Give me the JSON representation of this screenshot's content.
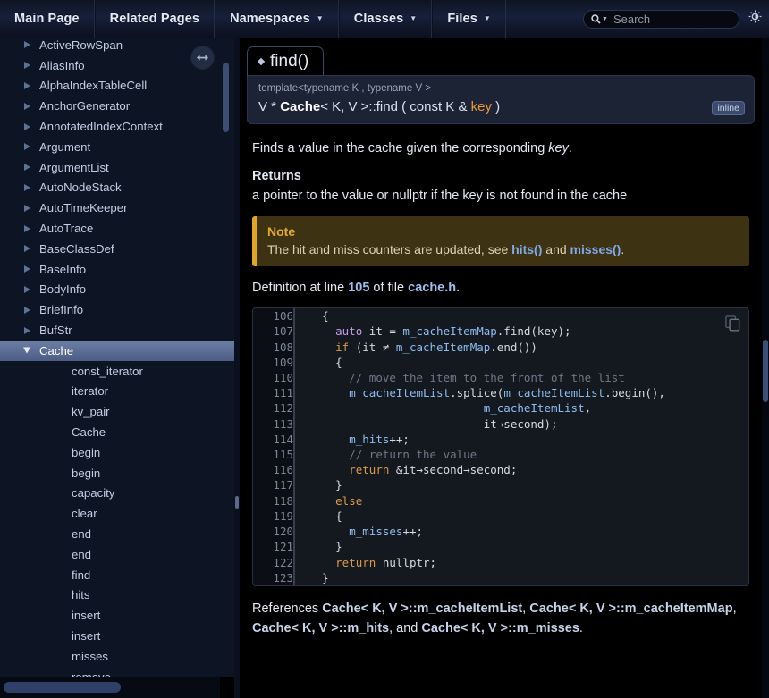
{
  "nav": {
    "tabs": [
      {
        "label": "Main Page",
        "caret": false
      },
      {
        "label": "Related Pages",
        "caret": false
      },
      {
        "label": "Namespaces",
        "caret": true
      },
      {
        "label": "Classes",
        "caret": true
      },
      {
        "label": "Files",
        "caret": true
      }
    ],
    "search_placeholder": "Search",
    "search_value": "",
    "search_icon": "magnifier-icon",
    "brightness_icon": "brightness-toggle-icon"
  },
  "sidebar": {
    "items": [
      {
        "label": "ActiveRowSpan",
        "level": 1,
        "expanded": false,
        "selected": false
      },
      {
        "label": "AliasInfo",
        "level": 1,
        "expanded": false,
        "selected": false
      },
      {
        "label": "AlphaIndexTableCell",
        "level": 1,
        "expanded": false,
        "selected": false
      },
      {
        "label": "AnchorGenerator",
        "level": 1,
        "expanded": false,
        "selected": false
      },
      {
        "label": "AnnotatedIndexContext",
        "level": 1,
        "expanded": false,
        "selected": false
      },
      {
        "label": "Argument",
        "level": 1,
        "expanded": false,
        "selected": false
      },
      {
        "label": "ArgumentList",
        "level": 1,
        "expanded": false,
        "selected": false
      },
      {
        "label": "AutoNodeStack",
        "level": 1,
        "expanded": false,
        "selected": false
      },
      {
        "label": "AutoTimeKeeper",
        "level": 1,
        "expanded": false,
        "selected": false
      },
      {
        "label": "AutoTrace",
        "level": 1,
        "expanded": false,
        "selected": false
      },
      {
        "label": "BaseClassDef",
        "level": 1,
        "expanded": false,
        "selected": false
      },
      {
        "label": "BaseInfo",
        "level": 1,
        "expanded": false,
        "selected": false
      },
      {
        "label": "BodyInfo",
        "level": 1,
        "expanded": false,
        "selected": false
      },
      {
        "label": "BriefInfo",
        "level": 1,
        "expanded": false,
        "selected": false
      },
      {
        "label": "BufStr",
        "level": 1,
        "expanded": false,
        "selected": false
      },
      {
        "label": "Cache",
        "level": 1,
        "expanded": true,
        "selected": true
      },
      {
        "label": "const_iterator",
        "level": 2,
        "expanded": false,
        "selected": false
      },
      {
        "label": "iterator",
        "level": 2,
        "expanded": false,
        "selected": false
      },
      {
        "label": "kv_pair",
        "level": 2,
        "expanded": false,
        "selected": false
      },
      {
        "label": "Cache",
        "level": 2,
        "expanded": false,
        "selected": false
      },
      {
        "label": "begin",
        "level": 2,
        "expanded": false,
        "selected": false
      },
      {
        "label": "begin",
        "level": 2,
        "expanded": false,
        "selected": false
      },
      {
        "label": "capacity",
        "level": 2,
        "expanded": false,
        "selected": false
      },
      {
        "label": "clear",
        "level": 2,
        "expanded": false,
        "selected": false
      },
      {
        "label": "end",
        "level": 2,
        "expanded": false,
        "selected": false
      },
      {
        "label": "end",
        "level": 2,
        "expanded": false,
        "selected": false
      },
      {
        "label": "find",
        "level": 2,
        "expanded": false,
        "selected": false
      },
      {
        "label": "hits",
        "level": 2,
        "expanded": false,
        "selected": false
      },
      {
        "label": "insert",
        "level": 2,
        "expanded": false,
        "selected": false
      },
      {
        "label": "insert",
        "level": 2,
        "expanded": false,
        "selected": false
      },
      {
        "label": "misses",
        "level": 2,
        "expanded": false,
        "selected": false
      },
      {
        "label": "remove",
        "level": 2,
        "expanded": false,
        "selected": false
      }
    ],
    "resize_handle_icon": "horizontal-resize-icon"
  },
  "member": {
    "tab_label": "find()",
    "template_line": "template<typename K , typename V >",
    "signature": {
      "return_type": "V * ",
      "class_name": "Cache",
      "class_template": "< K, V >::",
      "func_name": "find",
      "args_open": " ( const K & ",
      "param": "key",
      "args_close": " )"
    },
    "inline_badge": "inline"
  },
  "description": {
    "summary_pre": "Finds a value in the cache given the corresponding ",
    "summary_em": "key",
    "summary_post": ".",
    "returns_heading": "Returns",
    "returns_text": "a pointer to the value or nullptr if the key is not found in the cache"
  },
  "note": {
    "title": "Note",
    "pre": "The hit and miss counters are updated, see ",
    "link1": "hits()",
    "mid": " and ",
    "link2": "misses()",
    "post": "."
  },
  "definition": {
    "pre": "Definition at line ",
    "line": "105",
    "mid": " of file ",
    "file": "cache.h",
    "post": "."
  },
  "code": {
    "copy_icon": "copy-to-clipboard-icon",
    "lines": [
      {
        "no": "106",
        "frags": [
          {
            "t": "    {",
            "c": "pl"
          }
        ]
      },
      {
        "no": "107",
        "frags": [
          {
            "t": "      ",
            "c": "pl"
          },
          {
            "t": "auto",
            "c": "kw"
          },
          {
            "t": " it = ",
            "c": "pl"
          },
          {
            "t": "m_cacheItemMap",
            "c": "id"
          },
          {
            "t": ".find(key);",
            "c": "pl"
          }
        ]
      },
      {
        "no": "108",
        "frags": [
          {
            "t": "      ",
            "c": "pl"
          },
          {
            "t": "if",
            "c": "k"
          },
          {
            "t": " (it ≠ ",
            "c": "pl"
          },
          {
            "t": "m_cacheItemMap",
            "c": "id"
          },
          {
            "t": ".end())",
            "c": "pl"
          }
        ]
      },
      {
        "no": "109",
        "frags": [
          {
            "t": "      {",
            "c": "pl"
          }
        ]
      },
      {
        "no": "110",
        "frags": [
          {
            "t": "        ",
            "c": "pl"
          },
          {
            "t": "// move the item to the front of the list",
            "c": "cm"
          }
        ]
      },
      {
        "no": "111",
        "frags": [
          {
            "t": "        ",
            "c": "pl"
          },
          {
            "t": "m_cacheItemList",
            "c": "id"
          },
          {
            "t": ".splice(",
            "c": "pl"
          },
          {
            "t": "m_cacheItemList",
            "c": "id"
          },
          {
            "t": ".begin(),",
            "c": "pl"
          }
        ]
      },
      {
        "no": "112",
        "frags": [
          {
            "t": "                            ",
            "c": "pl"
          },
          {
            "t": "m_cacheItemList",
            "c": "id"
          },
          {
            "t": ",",
            "c": "pl"
          }
        ]
      },
      {
        "no": "113",
        "frags": [
          {
            "t": "                            it→second);",
            "c": "pl"
          }
        ]
      },
      {
        "no": "114",
        "frags": [
          {
            "t": "        ",
            "c": "pl"
          },
          {
            "t": "m_hits",
            "c": "id"
          },
          {
            "t": "++;",
            "c": "pl"
          }
        ]
      },
      {
        "no": "115",
        "frags": [
          {
            "t": "        ",
            "c": "pl"
          },
          {
            "t": "// return the value",
            "c": "cm"
          }
        ]
      },
      {
        "no": "116",
        "frags": [
          {
            "t": "        ",
            "c": "pl"
          },
          {
            "t": "return",
            "c": "k"
          },
          {
            "t": " &it→second→second;",
            "c": "pl"
          }
        ]
      },
      {
        "no": "117",
        "frags": [
          {
            "t": "      }",
            "c": "pl"
          }
        ]
      },
      {
        "no": "118",
        "frags": [
          {
            "t": "      ",
            "c": "pl"
          },
          {
            "t": "else",
            "c": "k"
          }
        ]
      },
      {
        "no": "119",
        "frags": [
          {
            "t": "      {",
            "c": "pl"
          }
        ]
      },
      {
        "no": "120",
        "frags": [
          {
            "t": "        ",
            "c": "pl"
          },
          {
            "t": "m_misses",
            "c": "id"
          },
          {
            "t": "++;",
            "c": "pl"
          }
        ]
      },
      {
        "no": "121",
        "frags": [
          {
            "t": "      }",
            "c": "pl"
          }
        ]
      },
      {
        "no": "122",
        "frags": [
          {
            "t": "      ",
            "c": "pl"
          },
          {
            "t": "return",
            "c": "k"
          },
          {
            "t": " nullptr;",
            "c": "pl"
          }
        ]
      },
      {
        "no": "123",
        "frags": [
          {
            "t": "    }",
            "c": "pl"
          }
        ]
      }
    ]
  },
  "references": {
    "prefix": "References ",
    "links": [
      "Cache< K, V >::m_cacheItemList",
      "Cache< K, V >::m_cacheItemMap",
      "Cache< K, V >::m_hits",
      "Cache< K, V >::m_misses"
    ],
    "sep": ", ",
    "and_word": ", and ",
    "suffix": "."
  },
  "colors": {
    "accent_note": "#e0a526",
    "selection": "#4c5d85",
    "link": "#9dc0ef",
    "param": "#e8973d"
  }
}
